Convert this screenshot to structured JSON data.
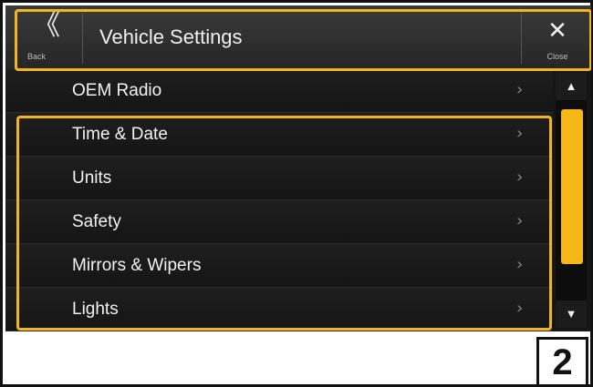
{
  "header": {
    "title": "Vehicle Settings",
    "back_label": "Back",
    "close_label": "Close",
    "back_icon": "double-chevron-left-icon",
    "close_icon": "close-icon"
  },
  "menu": {
    "items": [
      {
        "label": "OEM Radio"
      },
      {
        "label": "Time & Date"
      },
      {
        "label": "Units"
      },
      {
        "label": "Safety"
      },
      {
        "label": "Mirrors & Wipers"
      },
      {
        "label": "Lights"
      }
    ],
    "chevron_icon": "chevron-right-icon"
  },
  "scrollbar": {
    "up_icon": "arrow-up-icon",
    "down_icon": "arrow-down-icon",
    "thumb_color": "#f5b716"
  },
  "callout": {
    "step_number": "2",
    "highlight_color": "#f2b41f"
  }
}
